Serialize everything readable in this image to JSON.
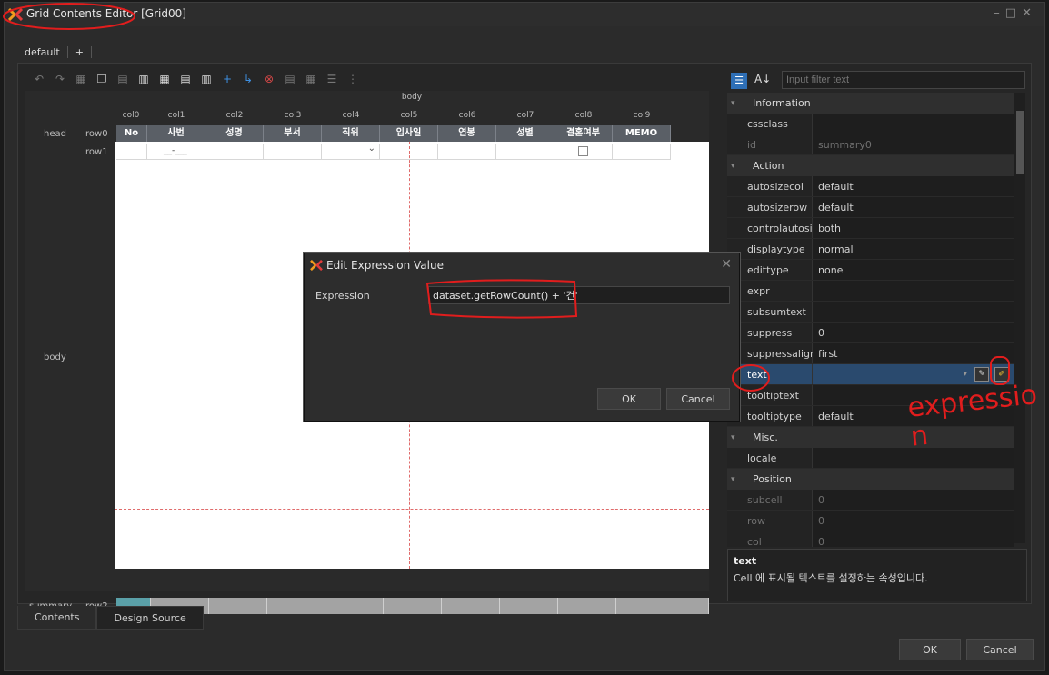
{
  "window": {
    "title": "Grid Contents Editor [Grid00]"
  },
  "workspace_tabs": [
    "default",
    "+"
  ],
  "filter_placeholder": "Input filter text",
  "grid": {
    "body_label": "body",
    "row_labels": {
      "head": "head",
      "row0": "row0",
      "row1": "row1",
      "body": "body",
      "summary": "summary",
      "row2": "row2"
    },
    "columns": [
      "col0",
      "col1",
      "col2",
      "col3",
      "col4",
      "col5",
      "col6",
      "col7",
      "col8",
      "col9"
    ],
    "header_cells": [
      "No",
      "사번",
      "성명",
      "부서",
      "직위",
      "입사일",
      "연봉",
      "성별",
      "결혼여부",
      "MEMO"
    ],
    "row1_masked": "__-___"
  },
  "properties": {
    "sections": [
      {
        "name": "Information",
        "rows": [
          {
            "name": "cssclass",
            "value": ""
          },
          {
            "name": "id",
            "value": "summary0",
            "dim": true
          }
        ]
      },
      {
        "name": "Action",
        "rows": [
          {
            "name": "autosizecol",
            "value": "default"
          },
          {
            "name": "autosizerow",
            "value": "default"
          },
          {
            "name": "controlautosizin",
            "value": "both"
          },
          {
            "name": "displaytype",
            "value": "normal"
          },
          {
            "name": "edittype",
            "value": "none"
          },
          {
            "name": "expr",
            "value": ""
          },
          {
            "name": "subsumtext",
            "value": ""
          },
          {
            "name": "suppress",
            "value": "0"
          },
          {
            "name": "suppressalign",
            "value": "first"
          },
          {
            "name": "text",
            "value": "",
            "selected": true
          },
          {
            "name": "tooltiptext",
            "value": ""
          },
          {
            "name": "tooltiptype",
            "value": "default"
          }
        ]
      },
      {
        "name": "Misc.",
        "rows": [
          {
            "name": "locale",
            "value": ""
          }
        ]
      },
      {
        "name": "Position",
        "rows": [
          {
            "name": "subcell",
            "value": "0",
            "dim": true
          },
          {
            "name": "row",
            "value": "0",
            "dim": true
          },
          {
            "name": "col",
            "value": "0",
            "dim": true
          }
        ]
      }
    ],
    "description": {
      "title": "text",
      "text": "Cell 에 표시될 텍스트를 설정하는 속성입니다."
    }
  },
  "bottom_tabs": [
    "Contents",
    "Design Source"
  ],
  "buttons": {
    "ok": "OK",
    "cancel": "Cancel"
  },
  "dialog": {
    "title": "Edit Expression Value",
    "expression_label": "Expression",
    "expression_value": "dataset.getRowCount() + '건'",
    "ok": "OK",
    "cancel": "Cancel"
  },
  "annotation": {
    "handwriting": "expression"
  },
  "colors": {
    "header": "#5a5f66",
    "summary_first": "#5aa0a8",
    "summary": "#a3a3a3",
    "selected_row": "#2a4a6e",
    "annotation": "#e11d1d"
  }
}
